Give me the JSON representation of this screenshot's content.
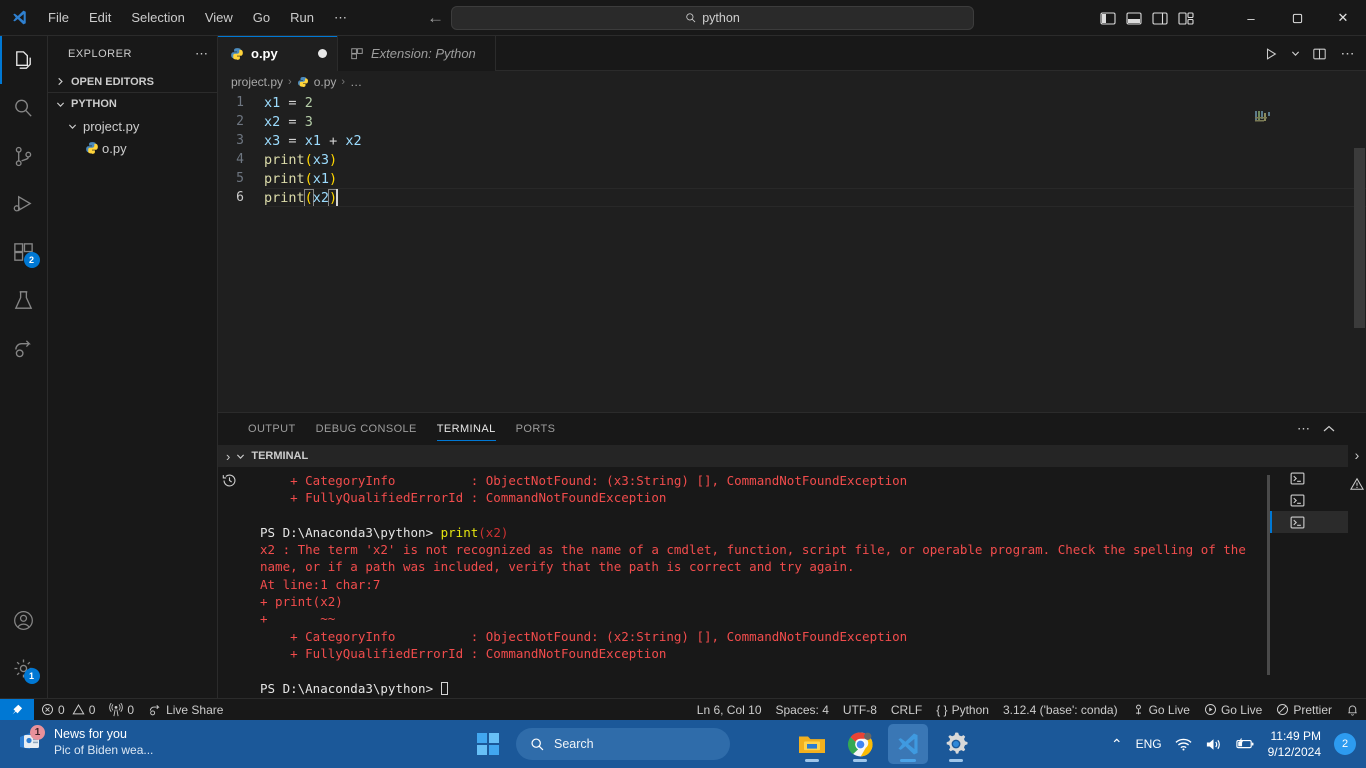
{
  "titlebar": {
    "menu": [
      "File",
      "Edit",
      "Selection",
      "View",
      "Go",
      "Run",
      "⋯"
    ],
    "search_value": "python",
    "back_label": "←",
    "forward_label": "→",
    "minimize": "–",
    "maximize": "❐",
    "close": "✕"
  },
  "activitybar": {
    "items": [
      {
        "name": "explorer",
        "icon": "files-icon",
        "badge": ""
      },
      {
        "name": "search",
        "icon": "search-icon",
        "badge": ""
      },
      {
        "name": "source-control",
        "icon": "source-control-icon",
        "badge": ""
      },
      {
        "name": "run-and-debug",
        "icon": "run-debug-icon",
        "badge": ""
      },
      {
        "name": "extensions",
        "icon": "extensions-icon",
        "badge": "2"
      },
      {
        "name": "testing",
        "icon": "beaker-icon",
        "badge": ""
      },
      {
        "name": "live-share",
        "icon": "live-share-icon",
        "badge": ""
      }
    ],
    "accounts_icon": "account-icon",
    "settings_icon": "gear-icon",
    "settings_badge": "1"
  },
  "sidebar": {
    "title": "EXPLORER",
    "more_actions": "⋯",
    "open_editors": "OPEN EDITORS",
    "root_folder": "PYTHON",
    "tree": [
      {
        "label": "project.py",
        "indent": 1,
        "type": "folder",
        "expanded": true
      },
      {
        "label": "o.py",
        "indent": 2,
        "type": "python-file"
      }
    ]
  },
  "editor": {
    "tabs": [
      {
        "label": "o.py",
        "icon": "python-file-icon",
        "active": true,
        "dirty": true
      },
      {
        "label": "Extension: Python",
        "icon": "extensions-icon",
        "active": false,
        "dirty": false
      }
    ],
    "breadcrumbs": [
      "project.py",
      "o.py",
      "…"
    ],
    "actions": [
      "run-python-file-button",
      "run-dropdown-button",
      "split-editor-button",
      "more-actions-button"
    ],
    "lines": [
      {
        "n": "1",
        "tokens": [
          {
            "t": "x1",
            "c": "tok-var"
          },
          {
            "t": " ",
            "c": "tok-op"
          },
          {
            "t": "=",
            "c": "tok-op"
          },
          {
            "t": " ",
            "c": "tok-op"
          },
          {
            "t": "2",
            "c": "tok-num"
          }
        ]
      },
      {
        "n": "2",
        "tokens": [
          {
            "t": "x2",
            "c": "tok-var"
          },
          {
            "t": " ",
            "c": "tok-op"
          },
          {
            "t": "=",
            "c": "tok-op"
          },
          {
            "t": " ",
            "c": "tok-op"
          },
          {
            "t": "3",
            "c": "tok-num"
          }
        ]
      },
      {
        "n": "3",
        "tokens": [
          {
            "t": "x3",
            "c": "tok-var"
          },
          {
            "t": " ",
            "c": "tok-op"
          },
          {
            "t": "=",
            "c": "tok-op"
          },
          {
            "t": " ",
            "c": "tok-op"
          },
          {
            "t": "x1",
            "c": "tok-var"
          },
          {
            "t": " ",
            "c": "tok-op"
          },
          {
            "t": "+",
            "c": "tok-op"
          },
          {
            "t": " ",
            "c": "tok-op"
          },
          {
            "t": "x2",
            "c": "tok-var"
          }
        ]
      },
      {
        "n": "4",
        "tokens": [
          {
            "t": "print",
            "c": "tok-fn"
          },
          {
            "t": "(",
            "c": "tok-paren"
          },
          {
            "t": "x3",
            "c": "tok-var"
          },
          {
            "t": ")",
            "c": "tok-paren"
          }
        ]
      },
      {
        "n": "5",
        "tokens": [
          {
            "t": "print",
            "c": "tok-fn"
          },
          {
            "t": "(",
            "c": "tok-paren"
          },
          {
            "t": "x1",
            "c": "tok-var"
          },
          {
            "t": ")",
            "c": "tok-paren"
          }
        ]
      },
      {
        "n": "6",
        "current": true,
        "tokens": [
          {
            "t": "print",
            "c": "tok-fn"
          },
          {
            "t": "(",
            "c": "tok-paren",
            "box": true
          },
          {
            "t": "x2",
            "c": "tok-var"
          },
          {
            "t": ")",
            "c": "tok-paren",
            "box": true
          }
        ]
      }
    ],
    "plain_text": "x1 = 2\nx2 = 3\nx3 = x1 + x2\nprint(x3)\nprint(x1)\nprint(x2)"
  },
  "panel": {
    "tabs": [
      "OUTPUT",
      "DEBUG CONSOLE",
      "TERMINAL",
      "PORTS"
    ],
    "active_tab": "TERMINAL",
    "actions": [
      "more-actions-button",
      "maximize-panel-button",
      "close-panel-button"
    ],
    "terminal_header": "TERMINAL",
    "terminal_list": [
      {
        "name": "terminal-1",
        "active": false
      },
      {
        "name": "terminal-2",
        "active": false
      },
      {
        "name": "terminal-3",
        "active": true
      }
    ],
    "terminal_lines": [
      [
        {
          "t": "    + CategoryInfo          : ObjectNotFound: (x3:String) [], CommandNotFoundException",
          "c": "t-err"
        }
      ],
      [
        {
          "t": "    + FullyQualifiedErrorId : CommandNotFoundException",
          "c": "t-err"
        }
      ],
      [
        {
          "t": "",
          "c": "t-err"
        }
      ],
      [
        {
          "t": "PS D:\\Anaconda3\\python> ",
          "c": "t-white"
        },
        {
          "t": "print",
          "c": "t-yellow"
        },
        {
          "t": "(x2)",
          "c": "t-orange"
        }
      ],
      [
        {
          "t": "x2 : The term 'x2' is not recognized as the name of a cmdlet, function, script file, or operable program. Check the spelling of the",
          "c": "t-err"
        }
      ],
      [
        {
          "t": "name, or if a path was included, verify that the path is correct and try again.",
          "c": "t-err"
        }
      ],
      [
        {
          "t": "At line:1 char:7",
          "c": "t-err"
        }
      ],
      [
        {
          "t": "+ print(x2)",
          "c": "t-err"
        }
      ],
      [
        {
          "t": "+       ~~",
          "c": "t-err"
        }
      ],
      [
        {
          "t": "    + CategoryInfo          : ObjectNotFound: (x2:String) [], CommandNotFoundException",
          "c": "t-err"
        }
      ],
      [
        {
          "t": "    + FullyQualifiedErrorId : CommandNotFoundException",
          "c": "t-err"
        }
      ],
      [
        {
          "t": "",
          "c": "t-err"
        }
      ],
      [
        {
          "t": "PS D:\\Anaconda3\\python> ",
          "c": "t-white",
          "cursor": true
        }
      ]
    ]
  },
  "statusbar": {
    "remote_icon": "remote-window-icon",
    "left_items": [
      {
        "name": "problems",
        "icon": "error-icon",
        "text": "0"
      },
      {
        "name": "warnings",
        "icon": "warning-icon",
        "text": "0"
      },
      {
        "name": "ports",
        "icon": "radio-tower-icon",
        "text": "0"
      },
      {
        "name": "live-share",
        "icon": "live-share-icon",
        "text": "Live Share"
      }
    ],
    "right_items": [
      {
        "name": "editor-position",
        "text": "Ln 6, Col 10"
      },
      {
        "name": "indentation",
        "text": "Spaces: 4"
      },
      {
        "name": "encoding",
        "text": "UTF-8"
      },
      {
        "name": "eol",
        "text": "CRLF"
      },
      {
        "name": "language-mode",
        "icon": "braces-icon",
        "text": "Python"
      },
      {
        "name": "python-interpreter",
        "text": "3.12.4 ('base': conda)"
      },
      {
        "name": "go-live-tunnel",
        "icon": "broadcast-icon",
        "text": "Go Live"
      },
      {
        "name": "go-live-server",
        "icon": "play-circle-icon",
        "text": "Go Live"
      },
      {
        "name": "prettier",
        "icon": "prettier-icon",
        "text": "Prettier"
      },
      {
        "name": "notifications",
        "icon": "bell-icon",
        "text": ""
      }
    ]
  },
  "taskbar": {
    "news_title": "News for you",
    "news_sub": "Pic of Biden wea...",
    "news_badge": "1",
    "search_placeholder": "Search",
    "apps": [
      {
        "name": "start-button",
        "icon": "windows-logo-icon"
      },
      {
        "name": "file-explorer",
        "icon": "folder-icon"
      },
      {
        "name": "google-chrome",
        "icon": "chrome-icon"
      },
      {
        "name": "visual-studio-code",
        "icon": "vscode-icon"
      },
      {
        "name": "settings",
        "icon": "gear-icon"
      }
    ],
    "tray": {
      "chevron": "⌃",
      "language": "ENG",
      "wifi_icon": "wifi-icon",
      "volume_icon": "volume-icon",
      "battery_icon": "battery-icon",
      "time": "11:49 PM",
      "date": "9/12/2024",
      "notification_count": "2"
    }
  },
  "colors": {
    "accent": "#0078d4",
    "error": "#f14c4c",
    "taskbar": "#1b5899",
    "editor_bg": "#1f1f1f",
    "chrome_bg": "#181818"
  }
}
